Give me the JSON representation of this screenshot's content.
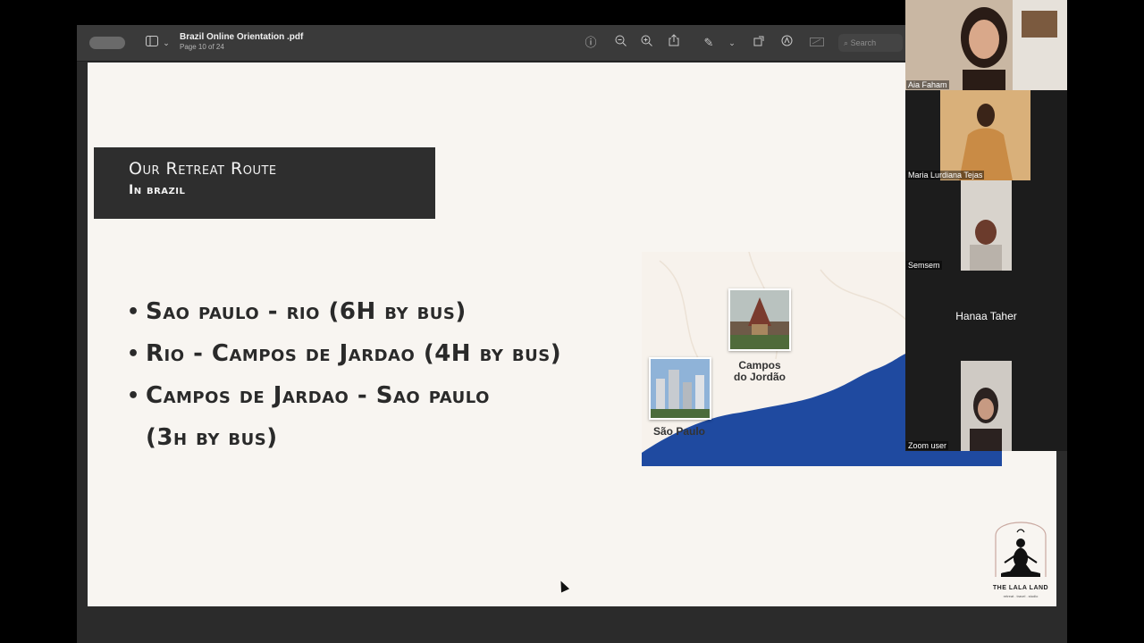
{
  "toolbar": {
    "doc_title": "Brazil Online Orientation .pdf",
    "page_info": "Page 10 of 24",
    "search_placeholder": "Search",
    "icons": [
      "sidebar-icon",
      "chevron-down-icon",
      "info-icon",
      "zoom-out-icon",
      "zoom-in-icon",
      "share-icon",
      "pen-icon",
      "chevron-down-icon",
      "rotate-icon",
      "markup-icon",
      "form-icon",
      "search-icon"
    ]
  },
  "slide": {
    "title": "Our Retreat Route",
    "subtitle": "In brazil",
    "bullets": [
      "Sao paulo - rio (6H by bus)",
      "Rio - Campos de Jardao (4H by bus)",
      "Campos de Jardao - Sao paulo"
    ],
    "bullet_continuation": "(3h by bus)",
    "map": {
      "label_campos_line1": "Campos",
      "label_campos_line2": "do Jordão",
      "label_sao_paulo": "São Paulo",
      "ocean_color": "#1f4aa0"
    },
    "logo": {
      "name": "THE LALA LAND",
      "tagline": "retreat . travel . studio"
    }
  },
  "participants": [
    {
      "name": "Aia Faham"
    },
    {
      "name": "Maria Lurdiana Tejas"
    },
    {
      "name": "Semsem"
    },
    {
      "name": "Hanaa Taher"
    },
    {
      "name": "Zoom user"
    }
  ]
}
